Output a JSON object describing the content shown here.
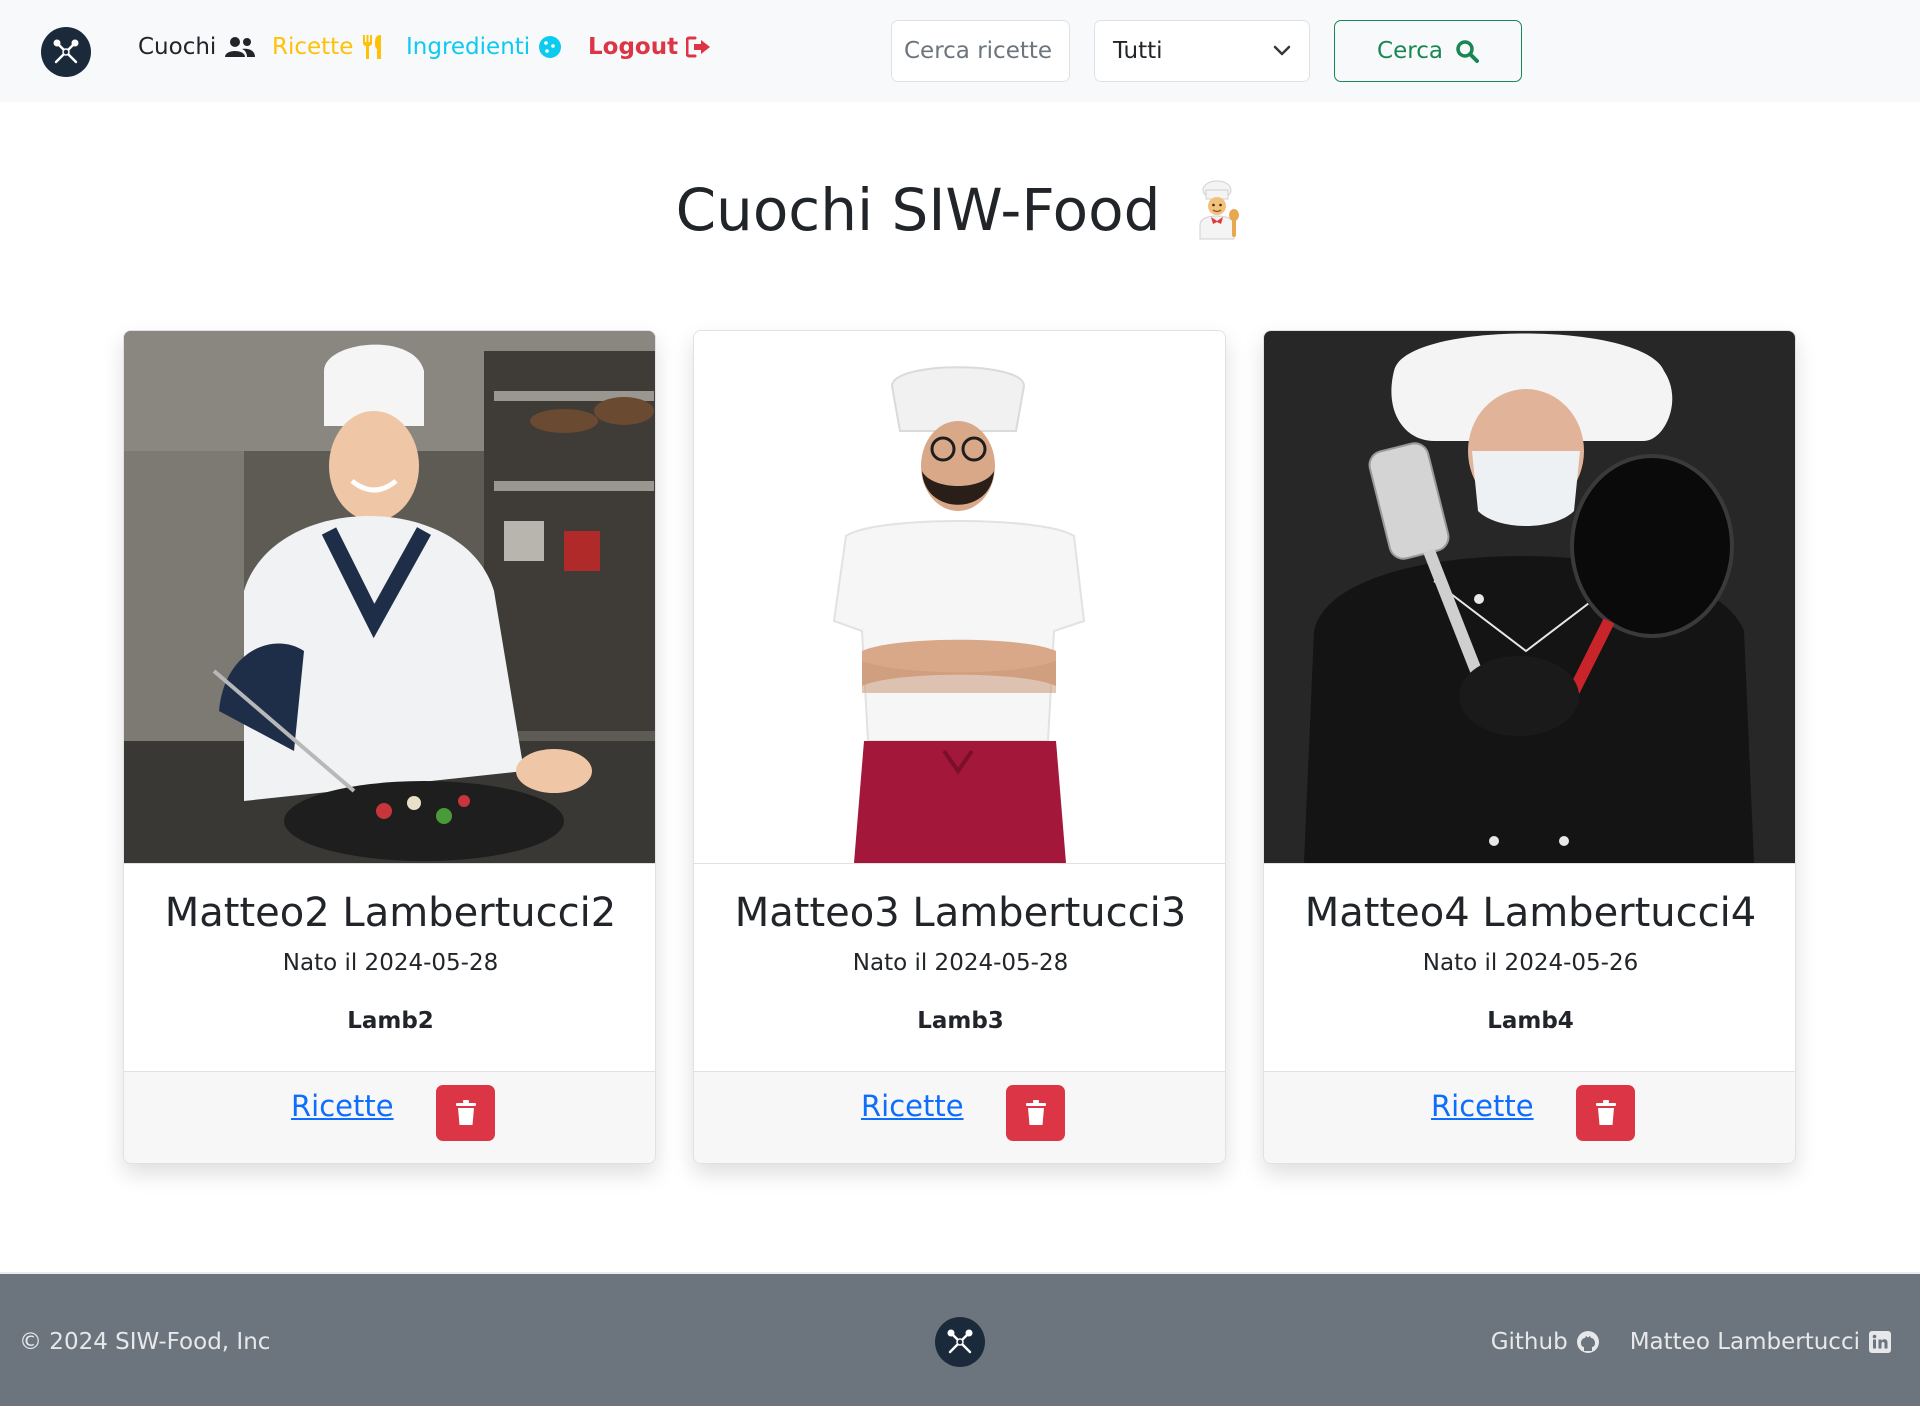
{
  "nav": {
    "cuochi_label": "Cuochi",
    "ricette_label": "Ricette",
    "ingredienti_label": "Ingredienti",
    "logout_label": "Logout",
    "search_placeholder": "Cerca ricette",
    "filter_selected": "Tutti",
    "search_button_label": "Cerca",
    "colors": {
      "cuochi": "#212529",
      "ricette": "#ffc107",
      "ingredienti": "#0dcaf0",
      "logout": "#dc3545",
      "search": "#198754"
    }
  },
  "page": {
    "title": "Cuochi SIW-Food"
  },
  "cards": [
    {
      "name": "Matteo2 Lambertucci2",
      "born": "Nato il 2024-05-28",
      "username": "Lamb2",
      "ricette_link": "Ricette",
      "photo": "chef-photo"
    },
    {
      "name": "Matteo3 Lambertucci3",
      "born": "Nato il 2024-05-28",
      "username": "Lamb3",
      "ricette_link": "Ricette",
      "photo": "chef-photo"
    },
    {
      "name": "Matteo4 Lambertucci4",
      "born": "Nato il 2024-05-26",
      "username": "Lamb4",
      "ricette_link": "Ricette",
      "photo": "chef-photo"
    }
  ],
  "footer": {
    "copyright": "© 2024 SIW-Food, Inc",
    "github_label": "Github",
    "linkedin_label": "Matteo Lambertucci"
  },
  "colors": {
    "danger": "#dc3545",
    "link": "#0d6efd",
    "footer_bg": "#6c757d",
    "navbar_bg": "#f8f9fa"
  }
}
